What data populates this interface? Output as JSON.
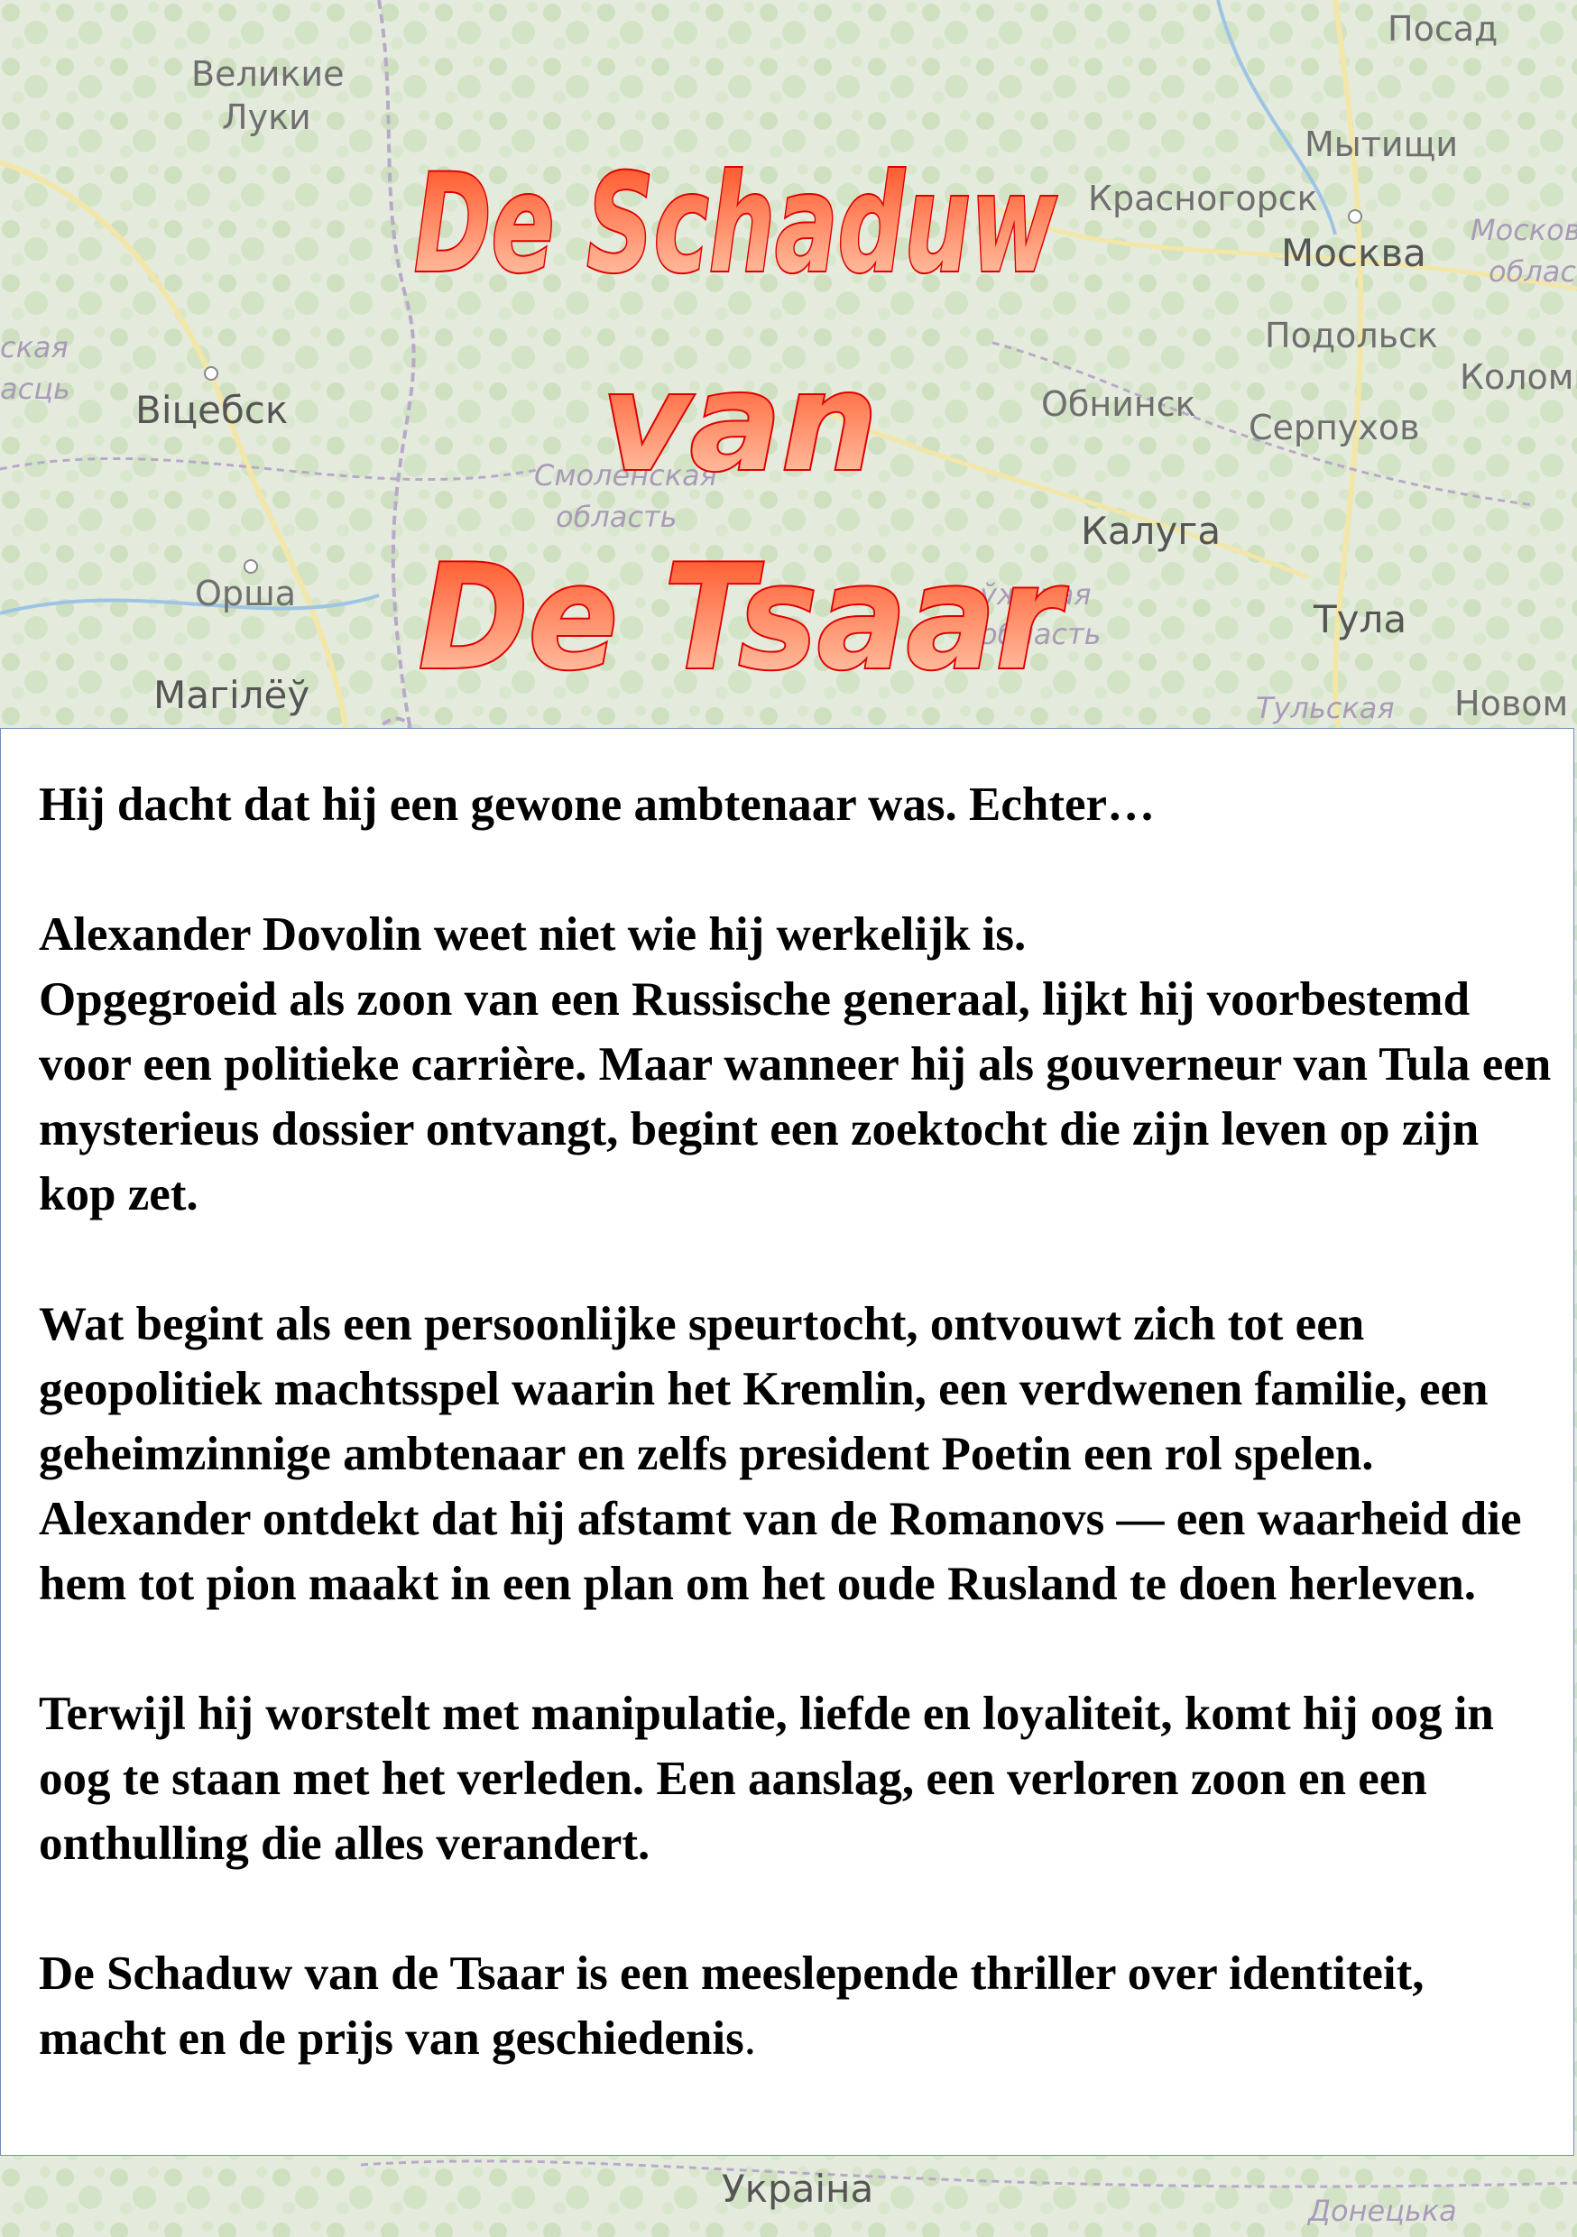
{
  "title": {
    "line1": "De Schaduw",
    "line2": "van",
    "line3": "De Tsaar"
  },
  "colors": {
    "title_stroke": "#e00000",
    "title_fill_top": "#ff4a1c",
    "title_fill_bottom": "#ffd3b8",
    "panel_border": "#6f8fbf"
  },
  "map": {
    "labels": [
      {
        "text": "Великие",
        "kind": "city"
      },
      {
        "text": "Луки",
        "kind": "city"
      },
      {
        "text": "Посад",
        "kind": "city"
      },
      {
        "text": "Мытищи",
        "kind": "city"
      },
      {
        "text": "Красногорск",
        "kind": "city"
      },
      {
        "text": "Москва",
        "kind": "capital"
      },
      {
        "text": "Москов",
        "kind": "region"
      },
      {
        "text": "облас",
        "kind": "region"
      },
      {
        "text": "Подольск",
        "kind": "city"
      },
      {
        "text": "Коломн",
        "kind": "city"
      },
      {
        "text": "ская",
        "kind": "region"
      },
      {
        "text": "асць",
        "kind": "region"
      },
      {
        "text": "Віцебск",
        "kind": "city"
      },
      {
        "text": "Обнинск",
        "kind": "city"
      },
      {
        "text": "Серпухов",
        "kind": "city"
      },
      {
        "text": "Смоленская",
        "kind": "region"
      },
      {
        "text": "область",
        "kind": "region"
      },
      {
        "text": "Калуга",
        "kind": "city"
      },
      {
        "text": "Орша",
        "kind": "city"
      },
      {
        "text": "Тула",
        "kind": "city"
      },
      {
        "text": "Магілёў",
        "kind": "city"
      },
      {
        "text": "Тульская",
        "kind": "region"
      },
      {
        "text": "Новом",
        "kind": "city"
      },
      {
        "text": "Украіна",
        "kind": "city"
      },
      {
        "text": "Донецька",
        "kind": "region"
      },
      {
        "text": "ўжская",
        "kind": "region"
      },
      {
        "text": "область",
        "kind": "region"
      }
    ]
  },
  "blurb": {
    "p1": "Hij dacht dat hij een gewone ambtenaar was. Echter…",
    "p2": "Alexander Dovolin weet niet wie hij werkelijk is.\nOpgegroeid als zoon van een Russische generaal, lijkt hij voorbestemd voor een politieke carrière. Maar wanneer hij als gouverneur van Tula een mysterieus dossier ontvangt, begint een zoektocht die zijn leven op zijn kop zet.",
    "p3": "Wat begint als een persoonlijke speurtocht, ontvouwt zich tot een geopolitiek machtsspel waarin het Kremlin, een verdwenen familie, een geheimzinnige ambtenaar en zelfs president Poetin een rol spelen. Alexander ontdekt dat hij afstamt van de Romanovs — een waarheid die hem tot pion maakt in een plan om het oude Rusland te doen herleven.",
    "p4": "Terwijl hij worstelt met manipulatie, liefde en loyaliteit, komt hij oog in oog te staan met het verleden. Een aanslag, een verloren zoon en een onthulling die alles verandert.",
    "p5": "De Schaduw van de Tsaar is een meeslepende thriller over identiteit, macht en de prijs van geschiedenis",
    "p5_tail": "."
  }
}
